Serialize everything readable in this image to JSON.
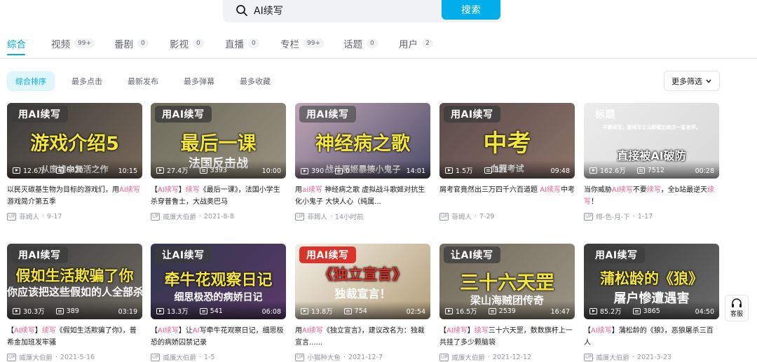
{
  "search": {
    "query": "AI续写",
    "button": "搜索"
  },
  "tabs": [
    {
      "label": "综合",
      "count": ""
    },
    {
      "label": "视频",
      "count": "99+"
    },
    {
      "label": "番剧",
      "count": "0"
    },
    {
      "label": "影视",
      "count": "0"
    },
    {
      "label": "直播",
      "count": "0"
    },
    {
      "label": "专栏",
      "count": "99+"
    },
    {
      "label": "话题",
      "count": "0"
    },
    {
      "label": "用户",
      "count": "2"
    }
  ],
  "sort": [
    "综合排序",
    "最多点击",
    "最新发布",
    "最多弹幕",
    "最多收藏"
  ],
  "more_filter": "更多筛选",
  "service_label": "客服",
  "up_tag": "UP",
  "videos": [
    {
      "badge": "用AI续写",
      "big": "游戏介绍5",
      "sub": "从废墟中复活之作",
      "views": "12.6万",
      "danmaku": "6820",
      "duration": "10:15",
      "title_parts": [
        "以民灭碳基生物为目标的游戏们，用",
        "AI续写",
        "游戏简介第五季"
      ],
      "author": "菲姆人",
      "date": "9-17"
    },
    {
      "badge": "用AI续写",
      "big": "最后一课",
      "sub": "法国反击战",
      "views": "27.4万",
      "danmaku": "3393",
      "duration": "10:00",
      "title_parts": [
        "【",
        "AI续写",
        "】",
        "续写",
        "《最后一课》，法国小学生杀穿普鲁士，大战奥巴马"
      ],
      "author": "威廉大伯爵",
      "date": "2021-8-8"
    },
    {
      "badge": "用AI续写",
      "big": "神经病之歌",
      "sub": "战斗恶姬暴揍小鬼子",
      "views": "390",
      "danmaku": "0",
      "duration": "14:01",
      "title_parts": [
        "用",
        "ai续写",
        " 神经病之歌 虚拟战斗歌姬对抗生化小鬼子 大快人心（纯属..."
      ],
      "author": "菲姆人",
      "date": "14小时前"
    },
    {
      "badge": "用AI续写",
      "big": "中考",
      "sub": "血腥考试",
      "views": "1.5万",
      "danmaku": "321",
      "duration": "09:48",
      "title_parts": [
        "屑考官竟然出三万四千六百道题 ",
        "AI续写",
        "中考"
      ],
      "author": "菲姆人",
      "date": "7-29"
    },
    {
      "badge": "标题",
      "big": "直接被AI破防",
      "sub": "不要续写，敢续写立马卸载加商店一星差评。",
      "views": "162.6万",
      "danmaku": "7512",
      "duration": "00:28",
      "title_parts": [
        "当你威胁",
        "AI续写",
        "不要",
        "续写",
        "，全b站最逆天",
        "续写",
        "！"
      ],
      "author": "绯-色-月-下",
      "date": "1-17"
    },
    {
      "badge": "用AI续写",
      "big": "假如生活欺骗了你",
      "sub": "你应该把这些假如的人全部杀掉",
      "views": "30.3万",
      "danmaku": "389",
      "duration": "03:19",
      "title_parts": [
        "【",
        "AI续写",
        "】",
        "续写",
        "《假如生活欺骗了你》，普希金加班发牢骚"
      ],
      "author": "威廉大伯爵",
      "date": "2021-5-16"
    },
    {
      "badge": "让AI续写",
      "big": "牵牛花观察日记",
      "sub": "细思极恐的病娇日记",
      "views": "13.3万",
      "danmaku": "541",
      "duration": "06:08",
      "title_parts": [
        "【",
        "AI续写",
        "】让",
        "AI",
        "写牵牛花观察日记，细思极恐的病娇囚禁记录"
      ],
      "author": "威廉大伯爵",
      "date": "1-5"
    },
    {
      "badge": "用AI续写",
      "big": "《独立宣言》",
      "sub": "独裁宣言！",
      "views": "13.8万",
      "danmaku": "754",
      "duration": "02:54",
      "title_parts": [
        "用",
        "AI续写",
        "《独立宣言》，建议改名为：独裁宣言......"
      ],
      "author": "小猫种大鱼",
      "date": "2021-12-7"
    },
    {
      "badge": "让AI续写",
      "big": "三十六天罡",
      "sub": "梁山海贼团传奇",
      "views": "16.5万",
      "danmaku": "2539",
      "duration": "16:47",
      "title_parts": [
        "【",
        "AI续写",
        "】",
        "续写",
        "三十六天罡，数数旗杆上一共挂了多少颗脑袋"
      ],
      "author": "威廉大伯爵",
      "date": "2021-12-12"
    },
    {
      "badge": "用AI续写",
      "big": "蒲松龄的《狼》",
      "sub": "屠户惨遭遇害",
      "views": "85.2万",
      "danmaku": "3865",
      "duration": "04:50",
      "title_parts": [
        "【",
        "AI续写",
        "】蒲松龄的《狼》，恶狼屠杀三百人"
      ],
      "author": "威廉大伯爵",
      "date": "2021-3-23"
    }
  ],
  "colors": {
    "accent": "#00aeec",
    "highlight": "#f25d8e"
  }
}
